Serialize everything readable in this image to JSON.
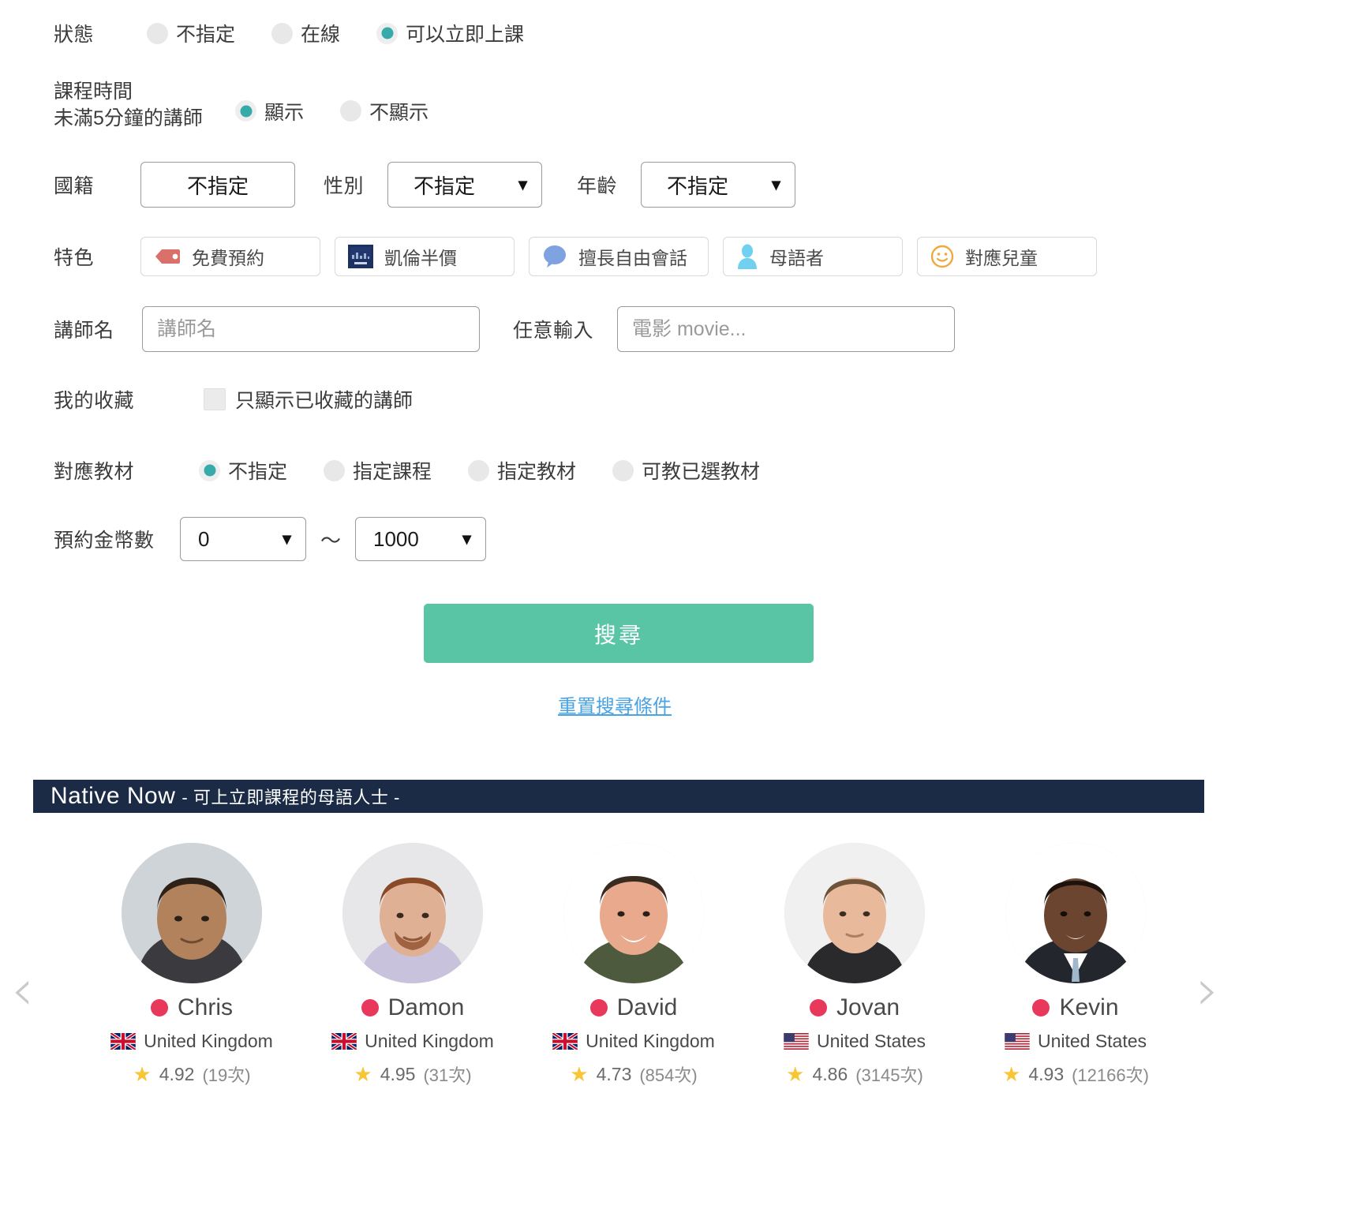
{
  "filters": {
    "status": {
      "label": "狀態",
      "options": [
        {
          "label": "不指定",
          "checked": false
        },
        {
          "label": "在線",
          "checked": false
        },
        {
          "label": "可以立即上課",
          "checked": true
        }
      ]
    },
    "lesson_time": {
      "label_line1": "課程時間",
      "label_line2": "未滿5分鐘的講師",
      "options": [
        {
          "label": "顯示",
          "checked": true
        },
        {
          "label": "不顯示",
          "checked": false
        }
      ]
    },
    "nationality": {
      "label": "國籍",
      "value": "不指定"
    },
    "gender": {
      "label": "性別",
      "value": "不指定"
    },
    "age": {
      "label": "年齡",
      "value": "不指定"
    },
    "features": {
      "label": "特色",
      "chips": [
        {
          "label": "免費預約",
          "icon": "price-tag-icon",
          "color": "#d9716a"
        },
        {
          "label": "凱倫半價",
          "icon": "callan-book-icon",
          "color": "#1c3160"
        },
        {
          "label": "擅長自由會話",
          "icon": "speech-bubble-icon",
          "color": "#7fa3e0"
        },
        {
          "label": "母語者",
          "icon": "person-icon",
          "color": "#6fd0f0"
        },
        {
          "label": "對應兒童",
          "icon": "smiley-face-icon",
          "color": "#f0a93c"
        }
      ]
    },
    "teacher_name": {
      "label": "講師名",
      "value": "",
      "placeholder": "講師名"
    },
    "free_input": {
      "label": "任意輸入",
      "value": "",
      "placeholder": "電影 movie..."
    },
    "favorites": {
      "label": "我的收藏",
      "checkbox_label": "只顯示已收藏的講師",
      "checked": false
    },
    "materials": {
      "label": "對應教材",
      "options": [
        {
          "label": "不指定",
          "checked": true
        },
        {
          "label": "指定課程",
          "checked": false
        },
        {
          "label": "指定教材",
          "checked": false
        },
        {
          "label": "可教已選教材",
          "checked": false
        }
      ]
    },
    "coins": {
      "label": "預約金幣數",
      "min": "0",
      "separator": "〜",
      "max": "1000"
    }
  },
  "actions": {
    "search_label": "搜尋",
    "reset_label": "重置搜尋條件"
  },
  "native_now": {
    "title": "Native Now",
    "subtitle": "- 可上立即課程的母語人士 -",
    "prev_arrow": "‹",
    "next_arrow": "›",
    "teachers": [
      {
        "name": "Chris",
        "country": "United Kingdom",
        "flag": "uk",
        "rating": "4.92",
        "count": "(19次)",
        "status": "online",
        "avatar_skin": "#b2825d",
        "avatar_hair": "#2e2118",
        "avatar_shirt": "#3b3b3f",
        "avatar_bg": "#cfd4d8"
      },
      {
        "name": "Damon",
        "country": "United Kingdom",
        "flag": "uk",
        "rating": "4.95",
        "count": "(31次)",
        "status": "online",
        "avatar_skin": "#e0b094",
        "avatar_hair": "#8a4a27",
        "avatar_shirt": "#c9c2dd",
        "avatar_bg": "#e7e7ea"
      },
      {
        "name": "David",
        "country": "United Kingdom",
        "flag": "uk",
        "rating": "4.73",
        "count": "(854次)",
        "status": "online",
        "avatar_skin": "#e8a98c",
        "avatar_hair": "#3a2b20",
        "avatar_shirt": "#4e5a3e",
        "avatar_bg": "#ffffff"
      },
      {
        "name": "Jovan",
        "country": "United States",
        "flag": "us",
        "rating": "4.86",
        "count": "(3145次)",
        "status": "online",
        "avatar_skin": "#e9b99c",
        "avatar_hair": "#6f5338",
        "avatar_shirt": "#2a2a2c",
        "avatar_bg": "#f0f0f0"
      },
      {
        "name": "Kevin",
        "country": "United States",
        "flag": "us",
        "rating": "4.93",
        "count": "(12166次)",
        "status": "online",
        "avatar_skin": "#6b4530",
        "avatar_hair": "#1d120c",
        "avatar_shirt": "#23262c",
        "avatar_bg": "#ffffff"
      }
    ]
  },
  "colors": {
    "accent_green": "#5ac5a5",
    "banner_navy": "#1b2b45",
    "radio_teal": "#37aaaa",
    "link_blue": "#4aa3e3",
    "status_red": "#e8385c",
    "star_yellow": "#f8c537"
  }
}
